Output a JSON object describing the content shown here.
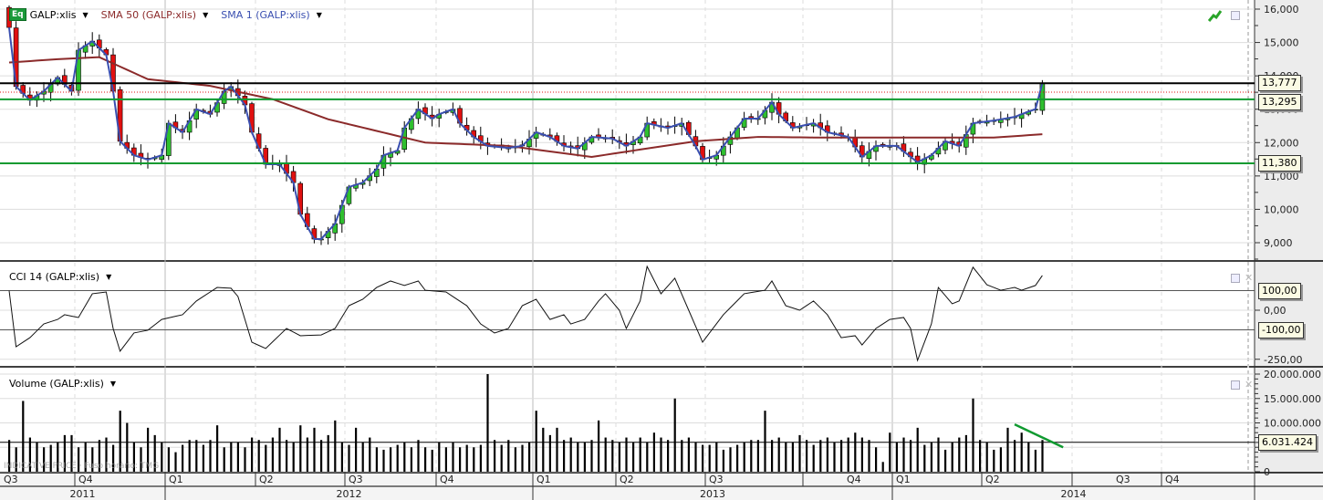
{
  "legend": {
    "symbol_badge": "Eq",
    "main": "GALP:xlis",
    "sma50": "SMA 50 (GALP:xlis)",
    "sma1": "SMA 1 (GALP:xlis)",
    "cci": "CCI 14 (GALP:xlis)",
    "volume": "Volume (GALP:xlis)"
  },
  "watermark": "INDICATIVE PRICE · Fuso horário: TMG",
  "colors": {
    "up": "#2fbf2f",
    "down": "#e01010",
    "sma1": "#3a4fb0",
    "sma50": "#8b2a2a",
    "hline_green": "#109a30",
    "hline_black": "#000000"
  },
  "chart_data": [
    {
      "type": "candlestick",
      "title": "GALP:xlis",
      "period": "weekly",
      "weeks": 150,
      "ylim": [
        8500,
        16200
      ],
      "yticks": [
        "9,000",
        "10,000",
        "11,000",
        "12,000",
        "13,000",
        "14,000",
        "15,000",
        "16,000"
      ],
      "ytick_values": [
        9000,
        10000,
        11000,
        12000,
        13000,
        14000,
        15000,
        16000
      ],
      "close_keyframes": [
        [
          0,
          15450
        ],
        [
          1,
          13680
        ],
        [
          3,
          13270
        ],
        [
          5,
          13540
        ],
        [
          7,
          13950
        ],
        [
          9,
          13540
        ],
        [
          10,
          14770
        ],
        [
          12,
          15040
        ],
        [
          14,
          14630
        ],
        [
          15,
          13540
        ],
        [
          16,
          12040
        ],
        [
          18,
          11620
        ],
        [
          20,
          11490
        ],
        [
          22,
          11620
        ],
        [
          23,
          12580
        ],
        [
          25,
          12310
        ],
        [
          27,
          13000
        ],
        [
          29,
          12850
        ],
        [
          31,
          13540
        ],
        [
          32,
          13680
        ],
        [
          34,
          13130
        ],
        [
          35,
          12310
        ],
        [
          37,
          11350
        ],
        [
          39,
          11350
        ],
        [
          41,
          10800
        ],
        [
          42,
          9850
        ],
        [
          44,
          9110
        ],
        [
          45,
          9110
        ],
        [
          47,
          9570
        ],
        [
          49,
          10670
        ],
        [
          51,
          10800
        ],
        [
          53,
          11210
        ],
        [
          54,
          11620
        ],
        [
          56,
          11760
        ],
        [
          57,
          12440
        ],
        [
          59,
          13000
        ],
        [
          61,
          12720
        ],
        [
          62,
          12850
        ],
        [
          64,
          13000
        ],
        [
          65,
          12580
        ],
        [
          67,
          12170
        ],
        [
          69,
          11900
        ],
        [
          72,
          11840
        ],
        [
          74,
          11900
        ],
        [
          76,
          12310
        ],
        [
          78,
          12170
        ],
        [
          80,
          11900
        ],
        [
          82,
          11820
        ],
        [
          84,
          12170
        ],
        [
          87,
          12120
        ],
        [
          89,
          11900
        ],
        [
          91,
          12170
        ],
        [
          92,
          12580
        ],
        [
          95,
          12440
        ],
        [
          97,
          12580
        ],
        [
          99,
          11900
        ],
        [
          100,
          11490
        ],
        [
          102,
          11620
        ],
        [
          104,
          12170
        ],
        [
          106,
          12720
        ],
        [
          108,
          12720
        ],
        [
          110,
          13210
        ],
        [
          111,
          12850
        ],
        [
          113,
          12440
        ],
        [
          116,
          12580
        ],
        [
          118,
          12310
        ],
        [
          121,
          12170
        ],
        [
          123,
          11570
        ],
        [
          125,
          11900
        ],
        [
          128,
          11900
        ],
        [
          131,
          11410
        ],
        [
          133,
          11620
        ],
        [
          135,
          12040
        ],
        [
          137,
          11900
        ],
        [
          139,
          12580
        ],
        [
          142,
          12660
        ],
        [
          145,
          12770
        ],
        [
          147,
          12930
        ],
        [
          148,
          13000
        ],
        [
          149,
          13777
        ]
      ],
      "sma50_keyframes": [
        [
          0,
          14400
        ],
        [
          7,
          14500
        ],
        [
          13,
          14560
        ],
        [
          20,
          13900
        ],
        [
          29,
          13700
        ],
        [
          38,
          13300
        ],
        [
          46,
          12700
        ],
        [
          54,
          12300
        ],
        [
          60,
          12000
        ],
        [
          72,
          11900
        ],
        [
          84,
          11570
        ],
        [
          90,
          11760
        ],
        [
          99,
          12040
        ],
        [
          108,
          12170
        ],
        [
          117,
          12150
        ],
        [
          130,
          12150
        ],
        [
          142,
          12150
        ],
        [
          149,
          12250
        ]
      ],
      "hlines": [
        {
          "value": 13777,
          "label": "13,777",
          "color": "#000000"
        },
        {
          "value": 13295,
          "label": "13,295",
          "color": "#109a30"
        },
        {
          "value": 11380,
          "label": "11,380",
          "color": "#109a30"
        }
      ],
      "dotted_line": 13510
    },
    {
      "type": "line",
      "title": "CCI 14 (GALP:xlis)",
      "ylim": [
        -260,
        245
      ],
      "yticks": [
        "0,00",
        "-250,00"
      ],
      "ytick_values": [
        0,
        -250
      ],
      "values_keyframes": [
        [
          0,
          100
        ],
        [
          1,
          -186
        ],
        [
          3,
          -140
        ],
        [
          5,
          -70
        ],
        [
          7,
          -47
        ],
        [
          8,
          -23
        ],
        [
          10,
          -37
        ],
        [
          12,
          84
        ],
        [
          14,
          93
        ],
        [
          15,
          -93
        ],
        [
          16,
          -209
        ],
        [
          18,
          -116
        ],
        [
          20,
          -102
        ],
        [
          22,
          -47
        ],
        [
          25,
          -23
        ],
        [
          27,
          47
        ],
        [
          30,
          116
        ],
        [
          32,
          112
        ],
        [
          33,
          70
        ],
        [
          35,
          -163
        ],
        [
          37,
          -195
        ],
        [
          40,
          -93
        ],
        [
          42,
          -130
        ],
        [
          45,
          -126
        ],
        [
          47,
          -93
        ],
        [
          49,
          23
        ],
        [
          51,
          56
        ],
        [
          53,
          116
        ],
        [
          55,
          149
        ],
        [
          57,
          126
        ],
        [
          59,
          149
        ],
        [
          60,
          102
        ],
        [
          63,
          93
        ],
        [
          66,
          23
        ],
        [
          68,
          -70
        ],
        [
          70,
          -116
        ],
        [
          72,
          -93
        ],
        [
          74,
          23
        ],
        [
          76,
          56
        ],
        [
          78,
          -47
        ],
        [
          80,
          -23
        ],
        [
          81,
          -70
        ],
        [
          83,
          -47
        ],
        [
          85,
          47
        ],
        [
          86,
          84
        ],
        [
          88,
          0
        ],
        [
          89,
          -93
        ],
        [
          91,
          47
        ],
        [
          92,
          223
        ],
        [
          94,
          84
        ],
        [
          96,
          163
        ],
        [
          98,
          0
        ],
        [
          100,
          -163
        ],
        [
          101,
          -116
        ],
        [
          103,
          -23
        ],
        [
          106,
          84
        ],
        [
          109,
          102
        ],
        [
          110,
          149
        ],
        [
          112,
          23
        ],
        [
          114,
          0
        ],
        [
          116,
          47
        ],
        [
          118,
          -23
        ],
        [
          120,
          -140
        ],
        [
          122,
          -130
        ],
        [
          123,
          -177
        ],
        [
          125,
          -93
        ],
        [
          127,
          -47
        ],
        [
          129,
          -37
        ],
        [
          130,
          -93
        ],
        [
          131,
          -256
        ],
        [
          133,
          -70
        ],
        [
          134,
          116
        ],
        [
          136,
          33
        ],
        [
          137,
          47
        ],
        [
          139,
          219
        ],
        [
          141,
          130
        ],
        [
          143,
          102
        ],
        [
          145,
          116
        ],
        [
          146,
          102
        ],
        [
          148,
          126
        ],
        [
          149,
          177
        ]
      ],
      "hlines": [
        {
          "value": 100,
          "label": "100,00",
          "color": "#e01010"
        },
        {
          "value": -100,
          "label": "-100,00",
          "color": "#109a30"
        }
      ]
    },
    {
      "type": "bar",
      "title": "Volume (GALP:xlis)",
      "ylim": [
        0,
        20500000
      ],
      "yticks": [
        "0",
        "10.000.000",
        "15.000.000",
        "20.000.000"
      ],
      "ytick_values": [
        0,
        10000000,
        15000000,
        20000000
      ],
      "values_millions": [
        6.5,
        5,
        14.5,
        7,
        6,
        5,
        5.5,
        6,
        7.5,
        7.5,
        5,
        6,
        5,
        6.5,
        7,
        5.5,
        12.5,
        10,
        6,
        5,
        9,
        7.5,
        6,
        5,
        4,
        5.5,
        6.5,
        6.5,
        5.5,
        6.5,
        9.5,
        5,
        6,
        6,
        5,
        7,
        6.5,
        5.5,
        7,
        9,
        6.5,
        6,
        9.5,
        7,
        9,
        6.5,
        7.5,
        10.5,
        6,
        5.5,
        9,
        6,
        7,
        5,
        4.5,
        5,
        5.5,
        6,
        5,
        6.5,
        5,
        4.5,
        6,
        5,
        6,
        5,
        5.5,
        5,
        5.5,
        20,
        6.5,
        5.5,
        6.5,
        5,
        5.5,
        6,
        12.5,
        9,
        7.5,
        9,
        6.5,
        7,
        6,
        6,
        6.5,
        10.5,
        7,
        6.5,
        6,
        7,
        6,
        7,
        6,
        8,
        7,
        6.5,
        15,
        6.5,
        7,
        6,
        5.5,
        5.5,
        6,
        4.5,
        5,
        5.5,
        6,
        6.5,
        6.5,
        12.5,
        6.5,
        7,
        6,
        6,
        7.5,
        6.5,
        5.5,
        6.5,
        7,
        6,
        6.5,
        7,
        8,
        7,
        6.5,
        5,
        2,
        8,
        6,
        7,
        6.5,
        9,
        5.5,
        6,
        7,
        4.5,
        6,
        7,
        7.5,
        15,
        6.5,
        6,
        4.5,
        5,
        9,
        6.5,
        8,
        6,
        4.5,
        6.5,
        6
      ],
      "hlines": [
        {
          "value": 6031424,
          "label": "6.031.424",
          "color": "#000000"
        }
      ],
      "trendline": [
        [
          145,
          9.7
        ],
        [
          152,
          5.0
        ]
      ]
    }
  ],
  "xaxis": {
    "quarters": [
      "Q3",
      "Q4",
      "Q1",
      "Q2",
      "Q3",
      "Q4",
      "Q1",
      "Q2",
      "Q3",
      "Q4",
      "Q1",
      "Q2",
      "Q3",
      "Q4"
    ],
    "years": [
      "2011",
      "2012",
      "2013",
      "2014"
    ]
  }
}
